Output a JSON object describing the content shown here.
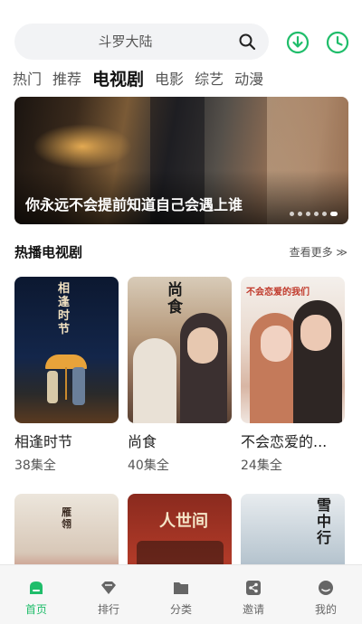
{
  "search": {
    "placeholder": "斗罗大陆"
  },
  "tabs": [
    {
      "label": "热门",
      "active": false
    },
    {
      "label": "推荐",
      "active": false
    },
    {
      "label": "电视剧",
      "active": true
    },
    {
      "label": "电影",
      "active": false
    },
    {
      "label": "综艺",
      "active": false
    },
    {
      "label": "动漫",
      "active": false
    }
  ],
  "banner": {
    "caption": "你永远不会提前知道自己会遇上谁",
    "dots": 6,
    "active_dot": 5
  },
  "section": {
    "title": "热播电视剧",
    "more": "查看更多 ≫"
  },
  "dramas": [
    {
      "title": "相逢时节",
      "episodes": "38集全",
      "poster_text": "相逢时节"
    },
    {
      "title": "尚食",
      "episodes": "40集全",
      "poster_text": "尚食"
    },
    {
      "title": "不会恋爱的...",
      "episodes": "24集全",
      "poster_text": "不会恋爱的我们"
    },
    {
      "title": "",
      "episodes": "",
      "poster_text": "雁翎"
    },
    {
      "title": "",
      "episodes": "",
      "poster_text": "人世间"
    },
    {
      "title": "",
      "episodes": "",
      "poster_text": "雪中行"
    }
  ],
  "nav": [
    {
      "label": "首页",
      "icon": "home-icon",
      "active": true
    },
    {
      "label": "排行",
      "icon": "ranking-icon",
      "active": false
    },
    {
      "label": "分类",
      "icon": "folder-icon",
      "active": false
    },
    {
      "label": "邀请",
      "icon": "share-icon",
      "active": false
    },
    {
      "label": "我的",
      "icon": "profile-icon",
      "active": false
    }
  ],
  "colors": {
    "accent": "#1fbd6a",
    "search_bg": "#f2f3f5"
  }
}
